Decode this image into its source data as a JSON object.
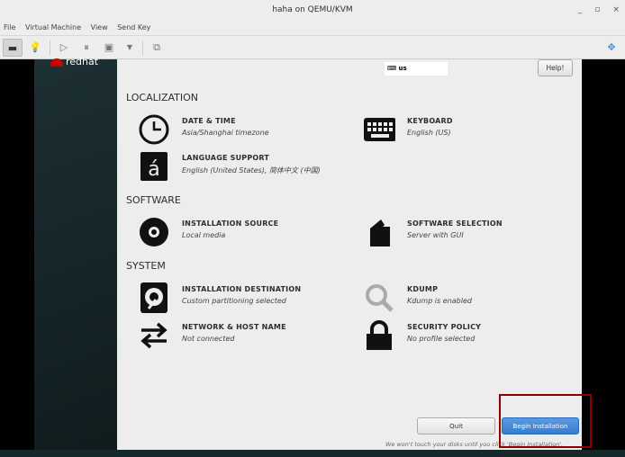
{
  "window": {
    "title": "haha on QEMU/KVM",
    "controls": [
      "minimize",
      "maximize",
      "close"
    ]
  },
  "menu": [
    "File",
    "Virtual Machine",
    "View",
    "Send Key"
  ],
  "toolbar": {
    "icons": [
      "console-icon",
      "lightbulb-icon",
      "play-icon",
      "pause-icon",
      "shutdown-icon",
      "dropdown-icon",
      "snapshot-icon",
      "fullscreen-move-icon"
    ]
  },
  "installer": {
    "logo": "redhat",
    "keyboard_indicator": "us",
    "help_label": "Help!",
    "sections": [
      {
        "title": "LOCALIZATION",
        "spokes": [
          {
            "title": "DATE & TIME",
            "status": "Asia/Shanghai timezone",
            "icon": "clock-icon"
          },
          {
            "title": "KEYBOARD",
            "status": "English (US)",
            "icon": "keyboard-icon"
          },
          {
            "title": "LANGUAGE SUPPORT",
            "status": "English (United States), 简体中文 (中国)",
            "icon": "language-icon"
          }
        ]
      },
      {
        "title": "SOFTWARE",
        "spokes": [
          {
            "title": "INSTALLATION SOURCE",
            "status": "Local media",
            "icon": "disc-icon"
          },
          {
            "title": "SOFTWARE SELECTION",
            "status": "Server with GUI",
            "icon": "package-icon"
          }
        ]
      },
      {
        "title": "SYSTEM",
        "spokes": [
          {
            "title": "INSTALLATION DESTINATION",
            "status": "Custom partitioning selected",
            "icon": "harddisk-icon"
          },
          {
            "title": "KDUMP",
            "status": "Kdump is enabled",
            "icon": "search-icon"
          },
          {
            "title": "NETWORK & HOST NAME",
            "status": "Not connected",
            "icon": "network-arrows-icon"
          },
          {
            "title": "SECURITY POLICY",
            "status": "No profile selected",
            "icon": "lock-icon"
          }
        ]
      }
    ],
    "quit_label": "Quit",
    "begin_label": "Begin Installation",
    "note": "We won't touch your disks until you click 'Begin Installation'."
  }
}
